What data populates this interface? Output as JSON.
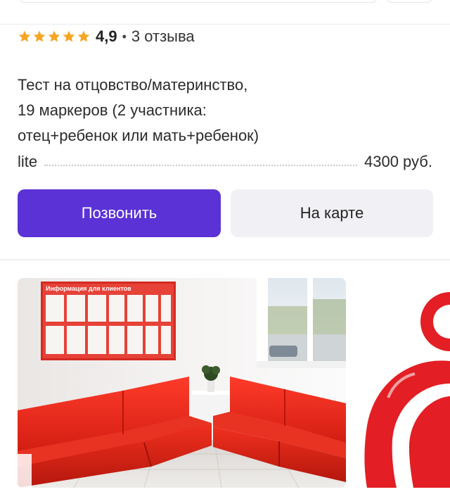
{
  "rating": {
    "value": "4,9",
    "separator": "•",
    "reviews": "3 отзыва",
    "stars": 5
  },
  "service": {
    "title_lines": [
      "Тест на отцовство/материнство,",
      "19 маркеров (2 участника:",
      "отец+ребенок или мать+ребенок)"
    ],
    "variant": "lite",
    "price": "4300 руб."
  },
  "actions": {
    "call_label": "Позвонить",
    "map_label": "На карте"
  },
  "gallery": {
    "sign_text": "Информация для клиентов"
  },
  "colors": {
    "accent": "#5a32d6",
    "star": "#f5a623",
    "sofa": "#e0251b",
    "map_button_bg": "#f1f1f5"
  }
}
